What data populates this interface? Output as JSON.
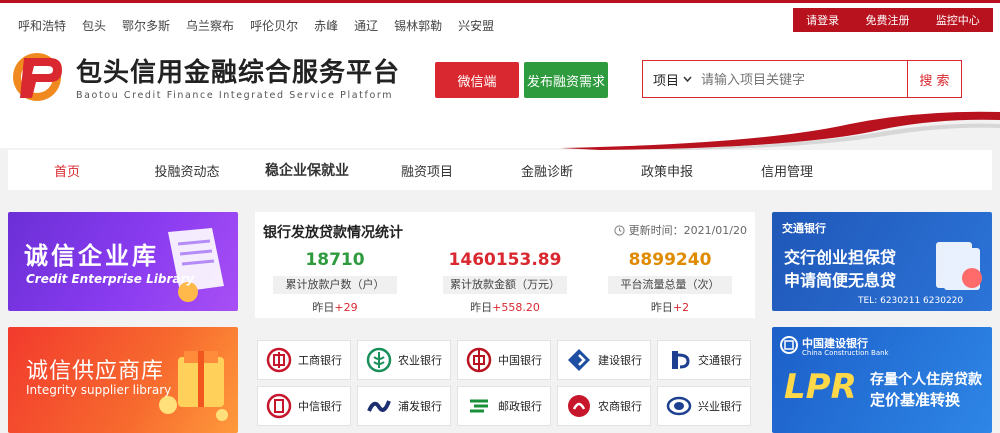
{
  "header": {
    "cities": [
      "呼和浩特",
      "包头",
      "鄂尔多斯",
      "乌兰察布",
      "呼伦贝尔",
      "赤峰",
      "通辽",
      "锡林郭勒",
      "兴安盟"
    ],
    "user_buttons": {
      "login": "请登录",
      "register": "免费注册",
      "monitor": "监控中心"
    },
    "logo_title": "包头信用金融综合服务平台",
    "logo_subtitle": "Baotou Credit Finance Integrated Service Platform",
    "wechat_label": "微信端",
    "publish_label": "发布融资需求",
    "search": {
      "select_value": "项目",
      "placeholder": "请输入项目关键字",
      "button": "搜 索"
    }
  },
  "nav": {
    "items": [
      "首页",
      "投融资动态",
      "稳企业保就业",
      "融资项目",
      "金融诊断",
      "政策申报",
      "信用管理"
    ]
  },
  "banners": {
    "enterprise": {
      "title": "诚信企业库",
      "subtitle": "Credit Enterprise Library"
    },
    "supplier": {
      "title": "诚信供应商库",
      "subtitle": "Integrity supplier library"
    },
    "bocom": {
      "brand": "交通银行",
      "line1": "交行创业担保贷",
      "line2": "申请简便无息贷",
      "tel": "TEL: 6230211  6230220"
    },
    "ccb": {
      "brand": "中国建设银行",
      "brand_en": "China Construction Bank",
      "big": "LPR",
      "line1": "存量个人住房贷款",
      "line2": "定价基准转换"
    }
  },
  "stats": {
    "title": "银行发放贷款情况统计",
    "updated": "更新时间：2021/01/20",
    "items": [
      {
        "value": "18710",
        "label": "累计放款户数（户）",
        "yesterday_prefix": "昨日",
        "yesterday_delta": "+29"
      },
      {
        "value": "1460153.89",
        "label": "累计放款金额（万元）",
        "yesterday_prefix": "昨日",
        "yesterday_delta": "+558.20"
      },
      {
        "value": "8899240",
        "label": "平台流量总量（次）",
        "yesterday_prefix": "昨日",
        "yesterday_delta": "+2"
      }
    ]
  },
  "banks": [
    "工商银行",
    "农业银行",
    "中国银行",
    "建设银行",
    "交通银行",
    "中信银行",
    "浦发银行",
    "邮政银行",
    "农商银行",
    "兴业银行"
  ],
  "colors": {
    "accent": "#d9282f",
    "green": "#2e9b3e",
    "value_green": "#2e9b3e",
    "value_red": "#d9282f",
    "value_orange": "#e08a00"
  }
}
